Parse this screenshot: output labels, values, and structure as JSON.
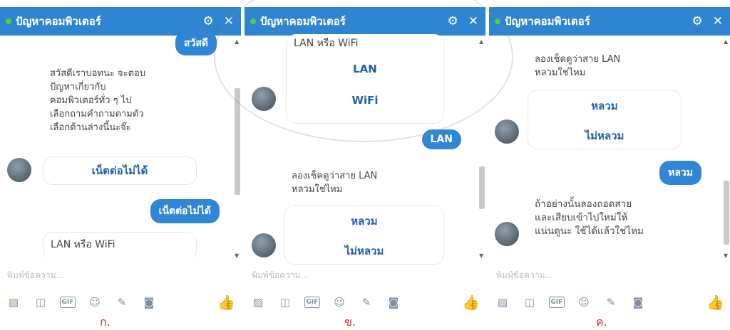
{
  "panels": [
    {
      "title": "ปัญหาคอมพิวเตอร์",
      "icons": {
        "settings": "gear-icon",
        "close": "close-icon"
      },
      "messages": {
        "out1": "สวัสดี",
        "bot1": "สวัสดีเราบอทนะ จะตอบปัญหาเกี่ยวกับคอมพิวเตอร์ทั่ว ๆ ไป เลือกถามคำถามตามตัวเลือกด้านล่างนี้นะจ๊ะ",
        "bot1_lines": [
          "สวัสดีเราบอทนะ จะตอบ",
          "ปัญหาเกี่ยวกับ",
          "คอมพิวเตอร์ทั่ว ๆ ไป",
          "เลือกถามคำถามตามตัว",
          "เลือกด้านล่างนี้นะจ๊ะ"
        ],
        "choice1": "เน็ตต่อไม่ได้",
        "out2": "เน็ตต่อไม่ได้",
        "bot2": "LAN หรือ WiFi"
      },
      "input_placeholder": "พิมพ์ข้อความ...",
      "label": "ก."
    },
    {
      "title": "ปัญหาคอมพิวเตอร์",
      "icons": {
        "settings": "gear-icon",
        "close": "close-icon"
      },
      "messages": {
        "bot1": "LAN หรือ WiFi",
        "choice1": "LAN",
        "choice2": "WiFi",
        "out1": "LAN",
        "bot2_lines": [
          "ลองเช็คดูว่าสาย LAN",
          "หลวมใช่ไหม"
        ],
        "choice3": "หลวม",
        "choice4": "ไม่หลวม"
      },
      "input_placeholder": "พิมพ์ข้อความ...",
      "label": "ข."
    },
    {
      "title": "ปัญหาคอมพิวเตอร์",
      "icons": {
        "settings": "gear-icon",
        "close": "close-icon"
      },
      "messages": {
        "bot1_lines": [
          "ลองเช็คดูว่าสาย LAN",
          "หลวมใช่ไหม"
        ],
        "choice1": "หลวม",
        "choice2": "ไม่หลวม",
        "out1": "หลวม",
        "bot2_lines": [
          "ถ้าอย่างนั้นลองถอดสาย",
          "และเสียบเข้าไปใหม่ให้",
          "แน่นดูนะ ใช้ได้แล้วใช่ไหม"
        ]
      },
      "input_placeholder": "พิมพ์ข้อความ...",
      "label": "ค."
    }
  ],
  "toolbar_icons": [
    "image-icon",
    "sticker-icon",
    "gif-icon",
    "emoji-icon",
    "attachment-icon",
    "camera-icon",
    "like-icon"
  ],
  "colors": {
    "header": "#2f84d0",
    "bubble_out": "#2e86d5",
    "choice_text": "#1d5fb0",
    "online_dot": "#49d33f",
    "label": "#e0223a"
  }
}
